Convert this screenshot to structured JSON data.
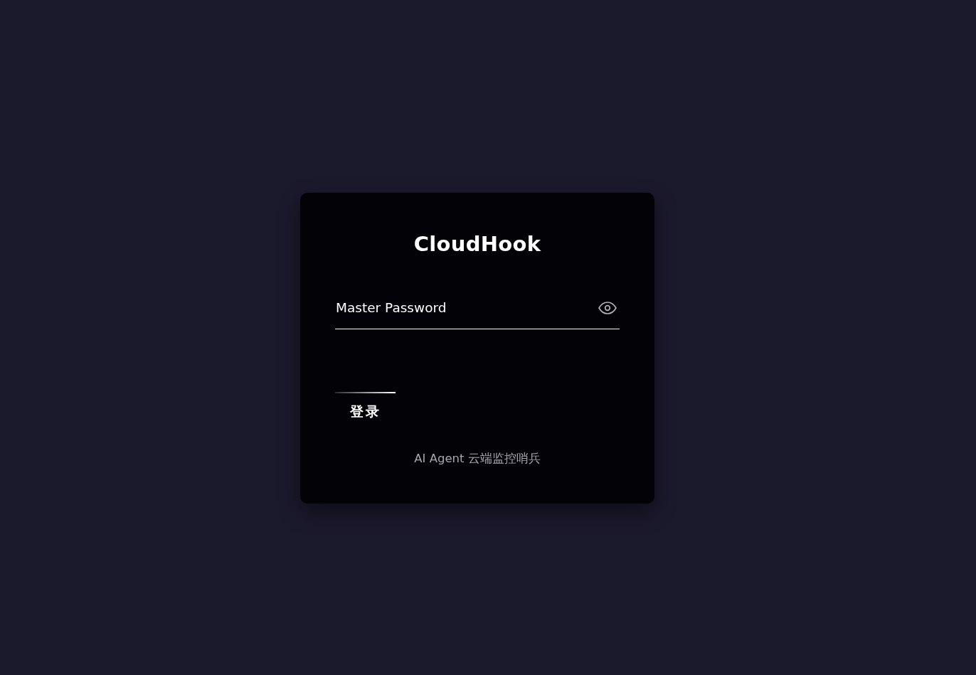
{
  "title": "CloudHook",
  "password_field": {
    "placeholder": "Master Password"
  },
  "login_button": {
    "label": "登录"
  },
  "footer": "AI Agent 云端监控哨兵"
}
